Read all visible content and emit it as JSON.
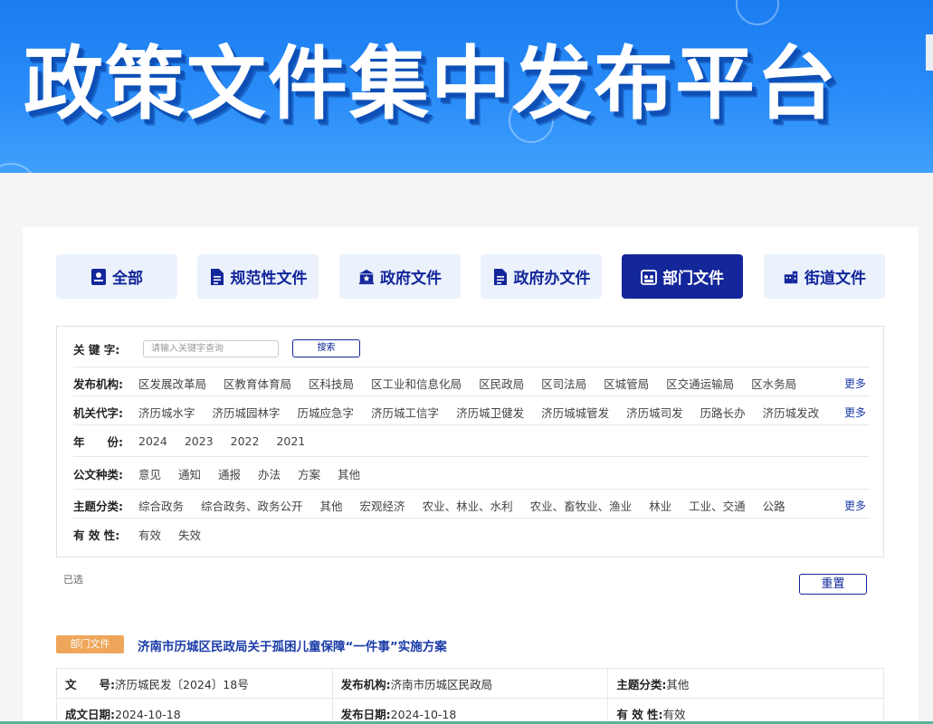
{
  "banner": {
    "title": "政策文件集中发布平台"
  },
  "tabs": [
    {
      "label": "全部",
      "icon": "id-card-icon"
    },
    {
      "label": "规范性文件",
      "icon": "document-icon"
    },
    {
      "label": "政府文件",
      "icon": "government-building-icon"
    },
    {
      "label": "政府办文件",
      "icon": "document-icon"
    },
    {
      "label": "部门文件",
      "icon": "department-icon",
      "active": true
    },
    {
      "label": "街道文件",
      "icon": "street-icon"
    }
  ],
  "filters": {
    "keyword": {
      "label": "关 键 字:",
      "placeholder": "请输入关键字查询",
      "search_label": "搜索"
    },
    "agency": {
      "label": "发布机构:",
      "options": [
        "区发展改革局",
        "区教育体育局",
        "区科技局",
        "区工业和信息化局",
        "区民政局",
        "区司法局",
        "区城管局",
        "区交通运输局",
        "区水务局"
      ],
      "more": "更多"
    },
    "code": {
      "label": "机关代字:",
      "options": [
        "济历城水字",
        "济历城园林字",
        "历城应急字",
        "济历城工信字",
        "济历城卫健发",
        "济历城城管发",
        "济历城司发",
        "历路长办",
        "济历城发改"
      ],
      "more": "更多"
    },
    "year": {
      "label": "年　　份:",
      "options": [
        "2024",
        "2023",
        "2022",
        "2021"
      ]
    },
    "doc_type": {
      "label": "公文种类:",
      "options": [
        "意见",
        "通知",
        "通报",
        "办法",
        "方案",
        "其他"
      ]
    },
    "topic": {
      "label": "主题分类:",
      "options": [
        "综合政务",
        "综合政务、政务公开",
        "其他",
        "宏观经济",
        "农业、林业、水利",
        "农业、畜牧业、渔业",
        "林业",
        "工业、交通",
        "公路"
      ],
      "more": "更多"
    },
    "validity": {
      "label": "有 效 性:",
      "options": [
        "有效",
        "失效"
      ]
    }
  },
  "selected_label": "已选",
  "reset_label": "重置",
  "result": {
    "tag": "部门文件",
    "title": "济南市历城区民政局关于孤困儿童保障“一件事”实施方案",
    "fields": {
      "doc_no_label": "文　　号:",
      "doc_no": "济历城民发〔2024〕18号",
      "agency_label": "发布机构:",
      "agency": "济南市历城区民政局",
      "topic_label": "主题分类:",
      "topic": "其他",
      "written_label": "成文日期:",
      "written": "2024-10-18",
      "publish_label": "发布日期:",
      "publish": "2024-10-18",
      "validity_label": "有 效 性:",
      "validity": "有效"
    }
  },
  "colors": {
    "brand": "#13269a",
    "tag": "#eea65a",
    "banner": "#1a7cf0"
  }
}
